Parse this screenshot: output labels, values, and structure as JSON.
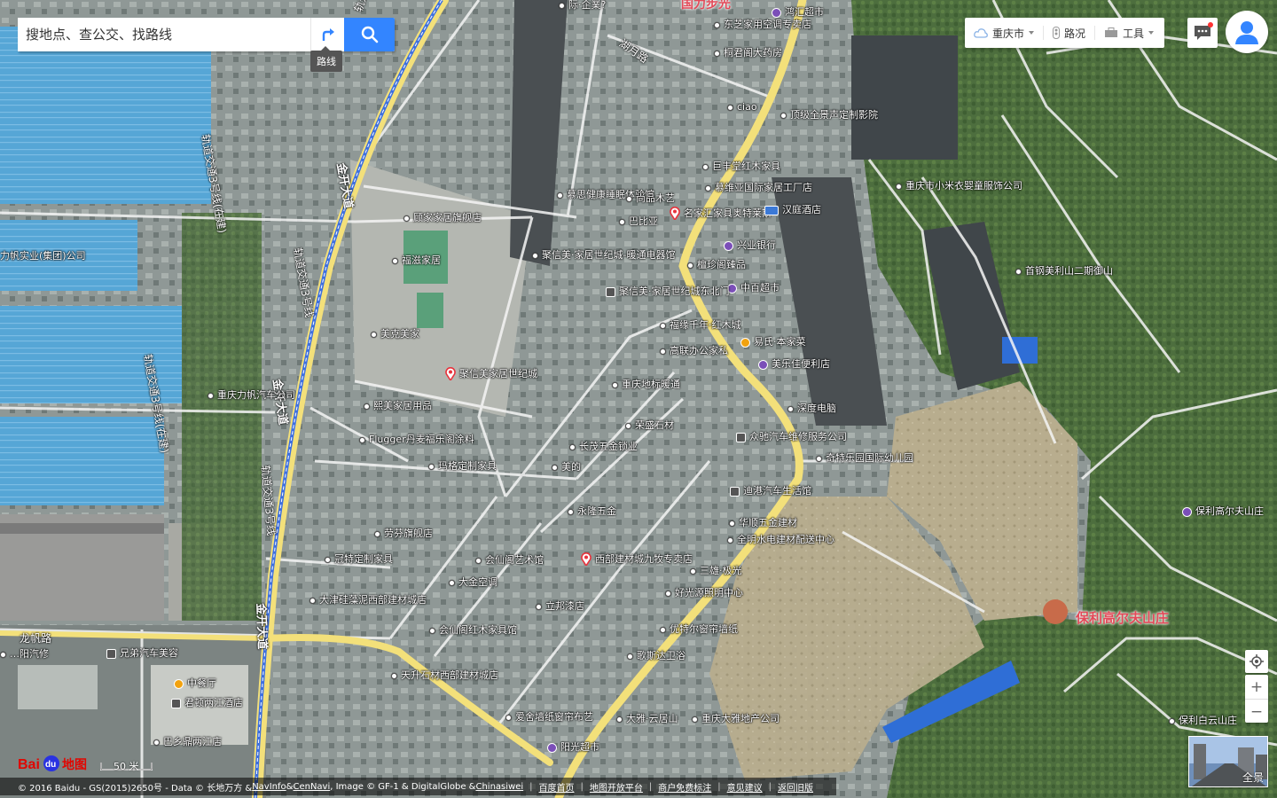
{
  "search": {
    "placeholder": "搜地点、查公交、找路线",
    "route_tooltip": "路线"
  },
  "toolbar": {
    "city": "重庆市",
    "traffic": "路况",
    "tools": "工具"
  },
  "roads": [
    {
      "label": "轨道交通3号线"
    },
    {
      "label": "金开大道"
    },
    {
      "label": "轨道交通3号线"
    },
    {
      "label": "金开大道"
    },
    {
      "label": "轨道交通3号线"
    },
    {
      "label": "金开大道"
    },
    {
      "label": "轨道交通3号线(在建)"
    },
    {
      "label": "轨道交通3号线(在建)"
    },
    {
      "label": "湖月路"
    },
    {
      "label": "龙帆路"
    }
  ],
  "pois": [
    {
      "name": "际·企業?",
      "kind": "dot"
    },
    {
      "name": "鸿汇超市",
      "kind": "badge"
    },
    {
      "name": "东芝家用空调专卖店",
      "kind": "dot"
    },
    {
      "name": "桐君阁大药房",
      "kind": "dot"
    },
    {
      "name": "ciao",
      "kind": "dot"
    },
    {
      "name": "顶级全景声定制影院",
      "kind": "dot"
    },
    {
      "name": "巨丰堂红木家具",
      "kind": "dot"
    },
    {
      "name": "慕思健康睡眠体验馆",
      "kind": "dot"
    },
    {
      "name": "尚品木艺",
      "kind": "dot"
    },
    {
      "name": "慕维亚国际家居工厂店",
      "kind": "dot"
    },
    {
      "name": "顾家家居旗舰店",
      "kind": "dot"
    },
    {
      "name": "巴比亚",
      "kind": "dot"
    },
    {
      "name": "名家汇家具奥特莱斯",
      "kind": "pin"
    },
    {
      "name": "汉庭酒店",
      "kind": "hotel"
    },
    {
      "name": "重庆市小米衣婴童服饰公司",
      "kind": "dot"
    },
    {
      "name": "兴业银行",
      "kind": "bank"
    },
    {
      "name": "福滋家居",
      "kind": "dot"
    },
    {
      "name": "聚信美·家居世纪城-暖通电器馆",
      "kind": "dot"
    },
    {
      "name": "檀珍阁臻品",
      "kind": "dot"
    },
    {
      "name": "首钢美利山二期御山",
      "kind": "dot"
    },
    {
      "name": "中百超市",
      "kind": "badge"
    },
    {
      "name": "聚信美·家居世纪城东北门",
      "kind": "gate"
    },
    {
      "name": "力帆实业(集团)公司",
      "kind": "none"
    },
    {
      "name": "美克美家",
      "kind": "dot"
    },
    {
      "name": "福缘千年·红木城",
      "kind": "dot"
    },
    {
      "name": "易氏·本家菜",
      "kind": "food"
    },
    {
      "name": "高联办公家私",
      "kind": "dot"
    },
    {
      "name": "美乐佳便利店",
      "kind": "badge"
    },
    {
      "name": "聚信美家居世纪城",
      "kind": "pin"
    },
    {
      "name": "重庆地标暖通",
      "kind": "dot"
    },
    {
      "name": "重庆力帆汽车公司",
      "kind": "dot"
    },
    {
      "name": "深度电脑",
      "kind": "dot"
    },
    {
      "name": "熙美家居用品",
      "kind": "dot"
    },
    {
      "name": "荣盛石材",
      "kind": "dot"
    },
    {
      "name": "众驰汽车维修服务公司",
      "kind": "car"
    },
    {
      "name": "奇特乐园国际幼儿园",
      "kind": "dot"
    },
    {
      "name": "Flugger丹麦福乐阁涂料",
      "kind": "dot"
    },
    {
      "name": "长茂五金锁业",
      "kind": "dot"
    },
    {
      "name": "玛格定制家具",
      "kind": "dot"
    },
    {
      "name": "美的",
      "kind": "dot"
    },
    {
      "name": "迪港汽车生活馆",
      "kind": "car"
    },
    {
      "name": "永隆五金",
      "kind": "dot"
    },
    {
      "name": "保利高尔夫山庄",
      "kind": "badge"
    },
    {
      "name": "华顺五金建材",
      "kind": "dot"
    },
    {
      "name": "劳芬旗舰店",
      "kind": "dot"
    },
    {
      "name": "全明水电建材配送中心",
      "kind": "dot"
    },
    {
      "name": "冠特定制家具",
      "kind": "dot"
    },
    {
      "name": "会仙阁艺术馆",
      "kind": "dot"
    },
    {
      "name": "西部建材城九牧专卖店",
      "kind": "pin"
    },
    {
      "name": "三雄·极光",
      "kind": "dot"
    },
    {
      "name": "大金空调",
      "kind": "dot"
    },
    {
      "name": "好光源照明中心",
      "kind": "dot"
    },
    {
      "name": "大津硅藻泥西部建材城店",
      "kind": "dot"
    },
    {
      "name": "立邦漆店",
      "kind": "dot"
    },
    {
      "name": "优特尔窗帘墙纸",
      "kind": "dot"
    },
    {
      "name": "会仙阁红木家具馆",
      "kind": "dot"
    },
    {
      "name": "兄弟汽车美容",
      "kind": "car"
    },
    {
      "name": "…阳汽修",
      "kind": "dot"
    },
    {
      "name": "中餐厅",
      "kind": "food"
    },
    {
      "name": "歌斯达卫浴",
      "kind": "dot"
    },
    {
      "name": "天升石材西部建材城店",
      "kind": "dot"
    },
    {
      "name": "君顿两江酒店",
      "kind": "hotel2"
    },
    {
      "name": "保利白云山庄",
      "kind": "dot"
    },
    {
      "name": "爱舍墙纸窗帘布艺",
      "kind": "dot"
    },
    {
      "name": "大雅·云居山",
      "kind": "dot"
    },
    {
      "name": "重庆大雅地产公司",
      "kind": "dot"
    },
    {
      "name": "巴乡鼎两江店",
      "kind": "dot"
    },
    {
      "name": "阳光超市",
      "kind": "badge"
    }
  ],
  "areas": [
    {
      "label": "保利高尔夫山庄"
    },
    {
      "label": "国力步光"
    }
  ],
  "controls": {
    "zoom_in": "+",
    "zoom_out": "−",
    "panorama": "全景"
  },
  "logo": {
    "text": "Bai地图"
  },
  "scale": {
    "label": "50 米"
  },
  "footer": {
    "copyright": "© 2016 Baidu - GS(2015)2650号 - Data © 长地万方 & ",
    "navinfo": "NavInfo",
    "amp1": " & ",
    "cennavi": "CenNavi",
    "image": " , Image © GF-1 & DigitalGlobe & ",
    "chinasiwei": "Chinasiwei",
    "links": [
      "百度首页",
      "地图开放平台",
      "商户免费标注",
      "意见建议",
      "返回旧版"
    ]
  },
  "colors": {
    "accent": "#3385ff",
    "pin": "#e8323c",
    "area_label": "#e24a59",
    "road_major": "#f3e07a"
  }
}
